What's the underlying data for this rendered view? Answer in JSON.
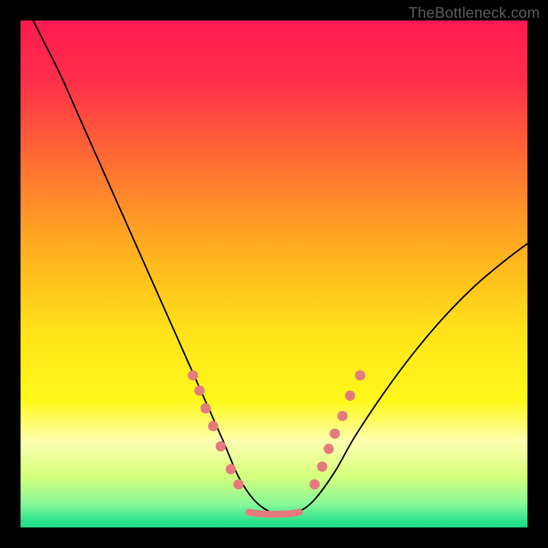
{
  "watermark": "TheBottleneck.com",
  "colors": {
    "background": "#000000",
    "gradient_stops": [
      {
        "offset": 0.0,
        "color": "#ff1a51"
      },
      {
        "offset": 0.12,
        "color": "#ff2f49"
      },
      {
        "offset": 0.28,
        "color": "#ff6f33"
      },
      {
        "offset": 0.45,
        "color": "#ffae1f"
      },
      {
        "offset": 0.62,
        "color": "#ffe419"
      },
      {
        "offset": 0.75,
        "color": "#fff81a"
      },
      {
        "offset": 0.83,
        "color": "#fdffb0"
      },
      {
        "offset": 0.9,
        "color": "#d4ff7a"
      },
      {
        "offset": 0.955,
        "color": "#86f89a"
      },
      {
        "offset": 0.985,
        "color": "#33e38e"
      },
      {
        "offset": 1.0,
        "color": "#18de85"
      }
    ],
    "curve": "#000000",
    "marker_fill": "#e47a7e",
    "marker_stroke": "#dc6e73"
  },
  "chart_data": {
    "type": "line",
    "title": "",
    "xlabel": "",
    "ylabel": "",
    "xlim": [
      0,
      100
    ],
    "ylim": [
      0,
      100
    ],
    "grid": false,
    "series": [
      {
        "name": "bottleneck-curve",
        "x": [
          0,
          4,
          8,
          12,
          16,
          20,
          24,
          28,
          32,
          36,
          40,
          43,
          46,
          49,
          52,
          55,
          58,
          62,
          66,
          72,
          78,
          84,
          90,
          96,
          100
        ],
        "y": [
          105,
          97,
          89,
          80,
          71,
          62,
          53,
          44,
          35,
          26,
          17,
          10,
          5.5,
          3.2,
          2.6,
          3.2,
          5.5,
          11,
          18,
          27,
          35,
          42,
          48,
          53,
          56
        ]
      }
    ],
    "markers_left": {
      "x": [
        34.0,
        35.3,
        36.5,
        38.0,
        39.5,
        41.5,
        43.0
      ],
      "y": [
        30.0,
        27.0,
        23.5,
        20.0,
        16.0,
        11.5,
        8.5
      ]
    },
    "markers_right": {
      "x": [
        58.0,
        59.5,
        60.8,
        62.0,
        63.5,
        65.0,
        67.0
      ],
      "y": [
        8.5,
        12.0,
        15.5,
        18.5,
        22.0,
        26.0,
        30.0
      ]
    },
    "bottom_band": {
      "x": [
        45.0,
        47.0,
        49.0,
        51.0,
        53.0,
        55.0
      ],
      "y": [
        3.0,
        2.7,
        2.6,
        2.6,
        2.7,
        3.0
      ],
      "thickness": 10
    }
  }
}
